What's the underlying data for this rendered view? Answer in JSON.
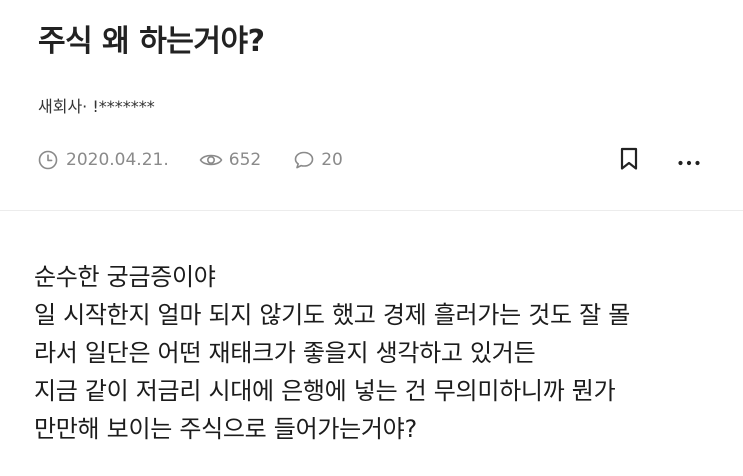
{
  "post": {
    "title": "주식 왜 하는거야?",
    "author": "새회사· !*******",
    "meta": {
      "date": "2020.04.21.",
      "views": "652",
      "comments": "20"
    },
    "body_lines": [
      "순수한 궁금증이야",
      "일 시작한지 얼마 되지 않기도 했고 경제 흘러가는 것도 잘 몰",
      "라서 일단은 어떤 재태크가 좋을지 생각하고 있거든",
      "지금 같이 저금리 시대에 은행에 넣는 건 무의미하니까 뭔가",
      "만만해 보이는 주식으로 들어가는거야?"
    ]
  },
  "icons": {
    "date": "clock-icon",
    "views": "eye-icon",
    "comments": "speech-bubble-icon",
    "bookmark": "bookmark-icon",
    "more": "more-dots-icon"
  },
  "colors": {
    "title": "#222222",
    "meta": "#8a8a8a",
    "divider": "#ececec",
    "body": "#1c1c1c"
  }
}
